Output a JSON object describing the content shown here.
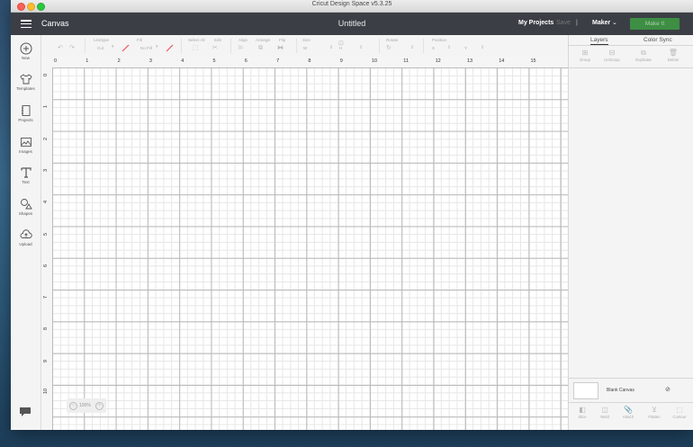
{
  "window": {
    "title": "Cricut Design Space  v5.3.25"
  },
  "header": {
    "section": "Canvas",
    "project_title": "Untitled",
    "my_projects": "My Projects",
    "save": "Save",
    "separator": "|",
    "machine": "Maker",
    "make_it": "Make It"
  },
  "sidebar": {
    "items": [
      {
        "label": "New",
        "icon": "plus-circle-icon"
      },
      {
        "label": "Templates",
        "icon": "tshirt-icon"
      },
      {
        "label": "Projects",
        "icon": "notebook-icon"
      },
      {
        "label": "Images",
        "icon": "image-icon"
      },
      {
        "label": "Text",
        "icon": "text-icon"
      },
      {
        "label": "Shapes",
        "icon": "shapes-icon"
      },
      {
        "label": "Upload",
        "icon": "cloud-upload-icon"
      }
    ]
  },
  "toolbar": {
    "linetype_label": "Linetype",
    "linetype_value": "Cut",
    "fill_label": "Fill",
    "fill_value": "No Fill",
    "select_all_label": "Select All",
    "edit_label": "Edit",
    "align_label": "Align",
    "arrange_label": "Arrange",
    "flip_label": "Flip",
    "size_label": "Size",
    "size_w": "W",
    "size_h": "H",
    "rotate_label": "Rotate",
    "position_label": "Position",
    "position_x": "X",
    "position_y": "Y"
  },
  "canvas": {
    "ruler_top": [
      "0",
      "1",
      "2",
      "3",
      "4",
      "5",
      "6",
      "7",
      "8",
      "9",
      "10",
      "11",
      "12",
      "13",
      "14",
      "15"
    ],
    "ruler_left": [
      "0",
      "1",
      "2",
      "3",
      "4",
      "5",
      "6",
      "7",
      "8",
      "9",
      "10"
    ],
    "zoom": "100%"
  },
  "layers_panel": {
    "tabs": [
      "Layers",
      "Color Sync"
    ],
    "tools": [
      "Group",
      "UnGroup",
      "Duplicate",
      "Delete"
    ],
    "blank_canvas": "Blank Canvas",
    "bottom_tools": [
      "Slice",
      "Weld",
      "Attach",
      "Flatten",
      "Contour"
    ]
  },
  "colors": {
    "header_bg": "#3b3f45",
    "make_it_bg": "#3e8e44"
  }
}
